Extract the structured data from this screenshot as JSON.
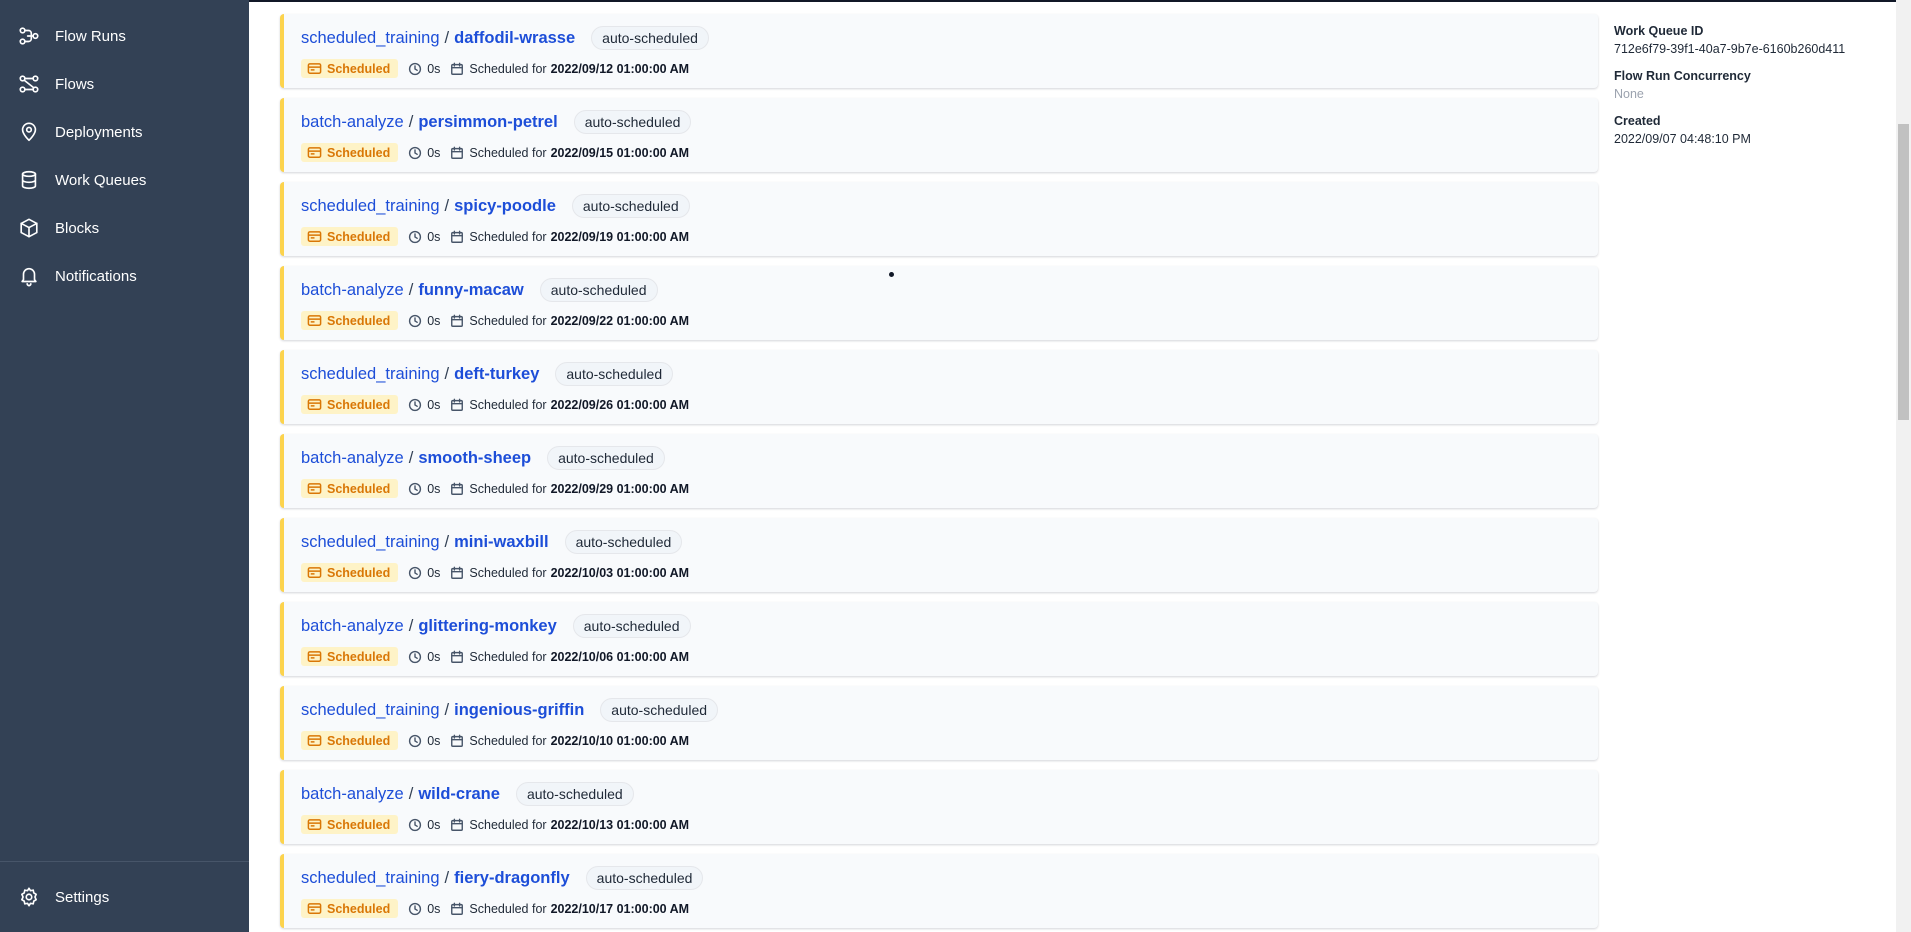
{
  "sidebar": {
    "items": [
      {
        "label": "Flow Runs",
        "icon": "flow-runs-icon"
      },
      {
        "label": "Flows",
        "icon": "flows-icon"
      },
      {
        "label": "Deployments",
        "icon": "map-pin-icon"
      },
      {
        "label": "Work Queues",
        "icon": "database-icon"
      },
      {
        "label": "Blocks",
        "icon": "cube-icon"
      },
      {
        "label": "Notifications",
        "icon": "bell-icon"
      }
    ],
    "settings": {
      "label": "Settings",
      "icon": "gear-icon"
    }
  },
  "runs": [
    {
      "flow": "scheduled_training",
      "sep": "/",
      "name": "daffodil-wrasse",
      "tag": "auto-scheduled",
      "state": "Scheduled",
      "duration": "0s",
      "scheduled_label": "Scheduled for",
      "scheduled_for": "2022/09/12 01:00:00 AM"
    },
    {
      "flow": "batch-analyze",
      "sep": "/",
      "name": "persimmon-petrel",
      "tag": "auto-scheduled",
      "state": "Scheduled",
      "duration": "0s",
      "scheduled_label": "Scheduled for",
      "scheduled_for": "2022/09/15 01:00:00 AM"
    },
    {
      "flow": "scheduled_training",
      "sep": "/",
      "name": "spicy-poodle",
      "tag": "auto-scheduled",
      "state": "Scheduled",
      "duration": "0s",
      "scheduled_label": "Scheduled for",
      "scheduled_for": "2022/09/19 01:00:00 AM"
    },
    {
      "flow": "batch-analyze",
      "sep": "/",
      "name": "funny-macaw",
      "tag": "auto-scheduled",
      "state": "Scheduled",
      "duration": "0s",
      "scheduled_label": "Scheduled for",
      "scheduled_for": "2022/09/22 01:00:00 AM"
    },
    {
      "flow": "scheduled_training",
      "sep": "/",
      "name": "deft-turkey",
      "tag": "auto-scheduled",
      "state": "Scheduled",
      "duration": "0s",
      "scheduled_label": "Scheduled for",
      "scheduled_for": "2022/09/26 01:00:00 AM"
    },
    {
      "flow": "batch-analyze",
      "sep": "/",
      "name": "smooth-sheep",
      "tag": "auto-scheduled",
      "state": "Scheduled",
      "duration": "0s",
      "scheduled_label": "Scheduled for",
      "scheduled_for": "2022/09/29 01:00:00 AM"
    },
    {
      "flow": "scheduled_training",
      "sep": "/",
      "name": "mini-waxbill",
      "tag": "auto-scheduled",
      "state": "Scheduled",
      "duration": "0s",
      "scheduled_label": "Scheduled for",
      "scheduled_for": "2022/10/03 01:00:00 AM"
    },
    {
      "flow": "batch-analyze",
      "sep": "/",
      "name": "glittering-monkey",
      "tag": "auto-scheduled",
      "state": "Scheduled",
      "duration": "0s",
      "scheduled_label": "Scheduled for",
      "scheduled_for": "2022/10/06 01:00:00 AM"
    },
    {
      "flow": "scheduled_training",
      "sep": "/",
      "name": "ingenious-griffin",
      "tag": "auto-scheduled",
      "state": "Scheduled",
      "duration": "0s",
      "scheduled_label": "Scheduled for",
      "scheduled_for": "2022/10/10 01:00:00 AM"
    },
    {
      "flow": "batch-analyze",
      "sep": "/",
      "name": "wild-crane",
      "tag": "auto-scheduled",
      "state": "Scheduled",
      "duration": "0s",
      "scheduled_label": "Scheduled for",
      "scheduled_for": "2022/10/13 01:00:00 AM"
    },
    {
      "flow": "scheduled_training",
      "sep": "/",
      "name": "fiery-dragonfly",
      "tag": "auto-scheduled",
      "state": "Scheduled",
      "duration": "0s",
      "scheduled_label": "Scheduled for",
      "scheduled_for": "2022/10/17 01:00:00 AM"
    }
  ],
  "details": {
    "work_queue_id_label": "Work Queue ID",
    "work_queue_id": "712e6f79-39f1-40a7-9b7e-6160b260d411",
    "concurrency_label": "Flow Run Concurrency",
    "concurrency": "None",
    "created_label": "Created",
    "created": "2022/09/07 04:48:10 PM"
  },
  "colors": {
    "sidebar_bg": "#334155",
    "link": "#1d4ed8",
    "scheduled_accent": "#fcd34d",
    "scheduled_text": "#d97706"
  }
}
